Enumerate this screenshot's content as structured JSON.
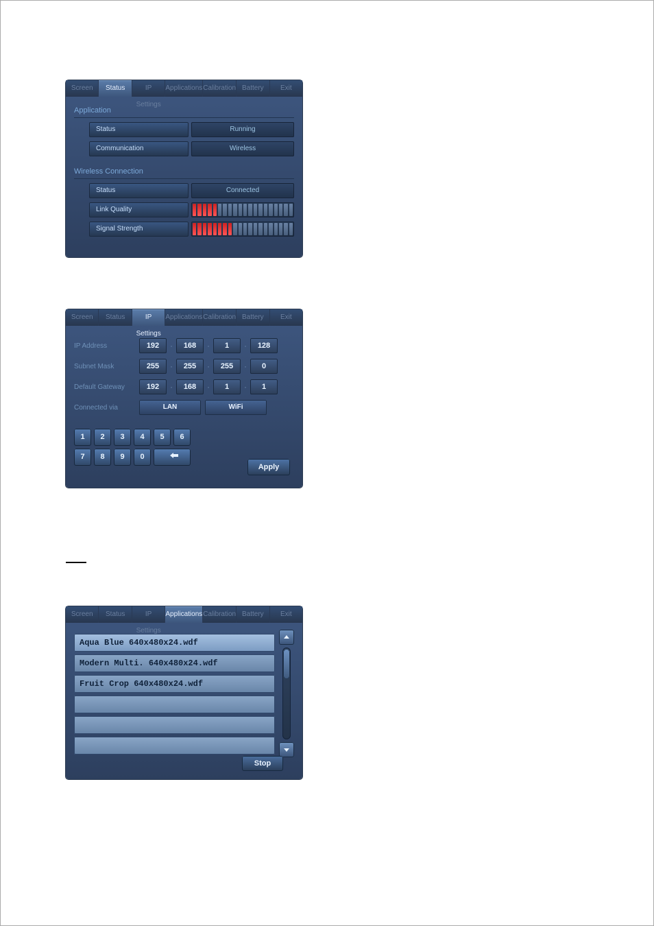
{
  "tabs": [
    "Screen",
    "Status",
    "IP Settings",
    "Applications",
    "Calibration",
    "Battery",
    "Exit"
  ],
  "shot1": {
    "activeTab": "Status",
    "groupA": "Application",
    "lab_status": "Status",
    "val_status": "Running",
    "lab_comm": "Communication",
    "val_comm": "Wireless",
    "groupB": "Wireless Connection",
    "lab_connstatus": "Status",
    "val_connstatus": "Connected",
    "lab_linkq": "Link Quality",
    "lab_sigs": "Signal Strength"
  },
  "chart_data": [
    {
      "type": "bar",
      "title": "Link Quality",
      "x": null,
      "values_pct_lit": 25,
      "segments": 20,
      "lit": 5
    },
    {
      "type": "bar",
      "title": "Signal Strength",
      "x": null,
      "values_pct_lit": 40,
      "segments": 20,
      "lit": 8
    }
  ],
  "shot2": {
    "activeTab": "IP Settings",
    "lab_ip": "IP Address",
    "ip": [
      "192",
      "168",
      "1",
      "128"
    ],
    "lab_mask": "Subnet Mask",
    "mask": [
      "255",
      "255",
      "255",
      "0"
    ],
    "lab_gw": "Default Gateway",
    "gw": [
      "192",
      "168",
      "1",
      "1"
    ],
    "lab_conn": "Connected via",
    "btn_lan": "LAN",
    "btn_wifi": "WiFi",
    "keys": [
      "1",
      "2",
      "3",
      "4",
      "5",
      "6",
      "7",
      "8",
      "9",
      "0"
    ],
    "apply": "Apply"
  },
  "shot3": {
    "activeTab": "Applications",
    "items": [
      "Aqua Blue 640x480x24.wdf",
      "Modern Multi. 640x480x24.wdf",
      "Fruit Crop 640x480x24.wdf"
    ],
    "stop": "Stop"
  }
}
